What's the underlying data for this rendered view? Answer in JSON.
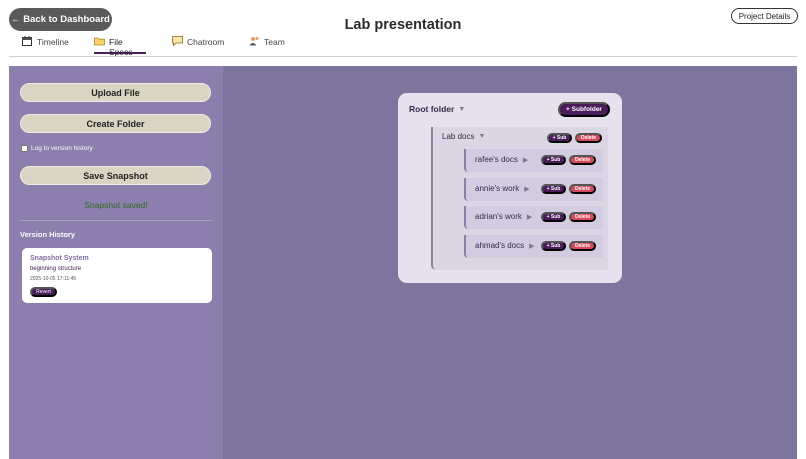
{
  "header": {
    "back_label": "← Back to Dashboard",
    "title": "Lab presentation",
    "details_label": "Project Details"
  },
  "tabs": [
    {
      "label": "Timeline",
      "icon": "calendar-icon"
    },
    {
      "label": "File Specs",
      "icon": "folder-icon",
      "active": true
    },
    {
      "label": "Chatroom",
      "icon": "chat-bubble-icon"
    },
    {
      "label": "Team",
      "icon": "people-icon"
    }
  ],
  "sidebar": {
    "upload_label": "Upload File",
    "create_folder_label": "Create Folder",
    "log_checkbox_label": "Log to version history",
    "log_checked": false,
    "save_snapshot_label": "Save Snapshot",
    "status_message": "Snapshot saved!",
    "version_history_title": "Version History",
    "snapshots": [
      {
        "name": "Snapshot System",
        "description": "beginning structure",
        "timestamp": "2025-10-05 17:11:45",
        "revert_label": "Revert"
      }
    ]
  },
  "tree": {
    "root_label": "Root folder",
    "root_toggle": "▼",
    "subfolder_label": "+ Subfolder",
    "folder": {
      "label": "Lab docs",
      "toggle": "▼",
      "sub_label": "+ Sub",
      "delete_label": "Delete",
      "children": [
        {
          "label": "rafee's docs",
          "toggle": "▶",
          "sub_label": "+ Sub",
          "delete_label": "Delete"
        },
        {
          "label": "annie's work",
          "toggle": "▶",
          "sub_label": "+ Sub",
          "delete_label": "Delete"
        },
        {
          "label": "adrian's work",
          "toggle": "▶",
          "sub_label": "+ Sub",
          "delete_label": "Delete"
        },
        {
          "label": "ahmad's docs",
          "toggle": "▶",
          "sub_label": "+ Sub",
          "delete_label": "Delete"
        }
      ]
    }
  },
  "colors": {
    "accent": "#4a1d5a",
    "danger": "#d64a5a",
    "sidebar_bg": "#8c7fad",
    "main_bg": "#7e759f",
    "success_text": "#2e6b1e"
  }
}
